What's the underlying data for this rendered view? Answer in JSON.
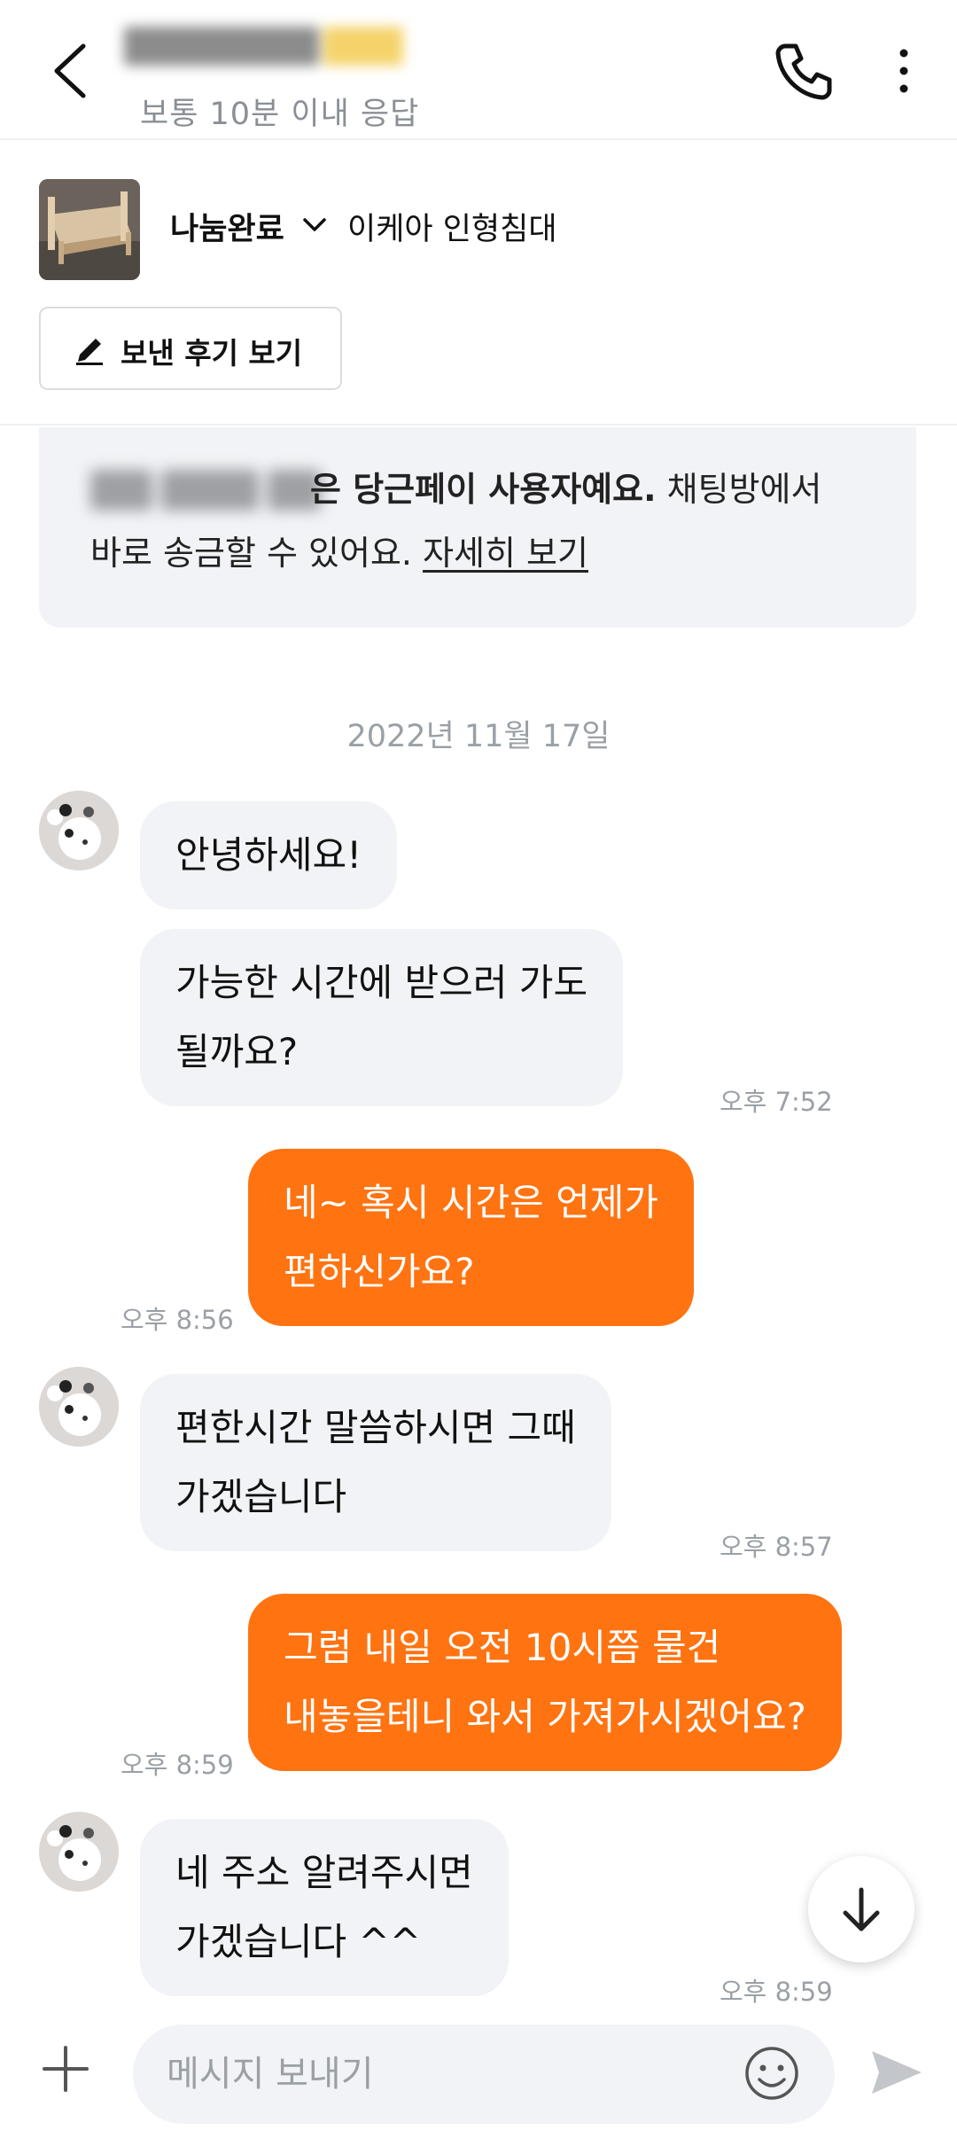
{
  "header": {
    "contact_name_masked": "",
    "response_time": "보통 10분 이내 응답"
  },
  "product": {
    "status": "나눔완료",
    "title": "이케아 인형침대",
    "review_button": "보낸 후기 보기"
  },
  "notice": {
    "masked_name_suffix": "은",
    "bold_text": "당근페이 사용자예요.",
    "line1_tail": "채팅방에서",
    "line2": "바로 송금할 수 있어요.",
    "link": "자세히 보기"
  },
  "chat": {
    "date": "2022년 11월 17일",
    "messages": [
      {
        "side": "in",
        "lines": [
          "안녕하세요!"
        ],
        "time": ""
      },
      {
        "side": "in",
        "lines": [
          "가능한 시간에 받으러 가도",
          "될까요?"
        ],
        "time": "오후 7:52"
      },
      {
        "side": "out",
        "lines": [
          "네~ 혹시 시간은 언제가",
          "편하신가요?"
        ],
        "time": "오후 8:56"
      },
      {
        "side": "in",
        "lines": [
          "편한시간 말씀하시면 그때",
          "가겠습니다"
        ],
        "time": "오후 8:57"
      },
      {
        "side": "out",
        "lines": [
          "그럼 내일 오전 10시쯤 물건",
          "내놓을테니 와서 가져가시겠어요?"
        ],
        "time": "오후 8:59"
      },
      {
        "side": "in",
        "lines": [
          "네 주소 알려주시면",
          "가겠습니다 ^^"
        ],
        "time": "오후 8:59"
      }
    ]
  },
  "input": {
    "placeholder": "메시지 보내기",
    "value": ""
  },
  "colors": {
    "accent": "#ff7311",
    "bubble_in": "#f2f3f6",
    "muted_text": "#9aa0a6"
  },
  "icons": [
    "back-arrow-icon",
    "phone-icon",
    "more-vertical-icon",
    "chevron-down-icon",
    "pencil-icon",
    "arrow-down-icon",
    "plus-icon",
    "smile-icon",
    "send-icon"
  ]
}
